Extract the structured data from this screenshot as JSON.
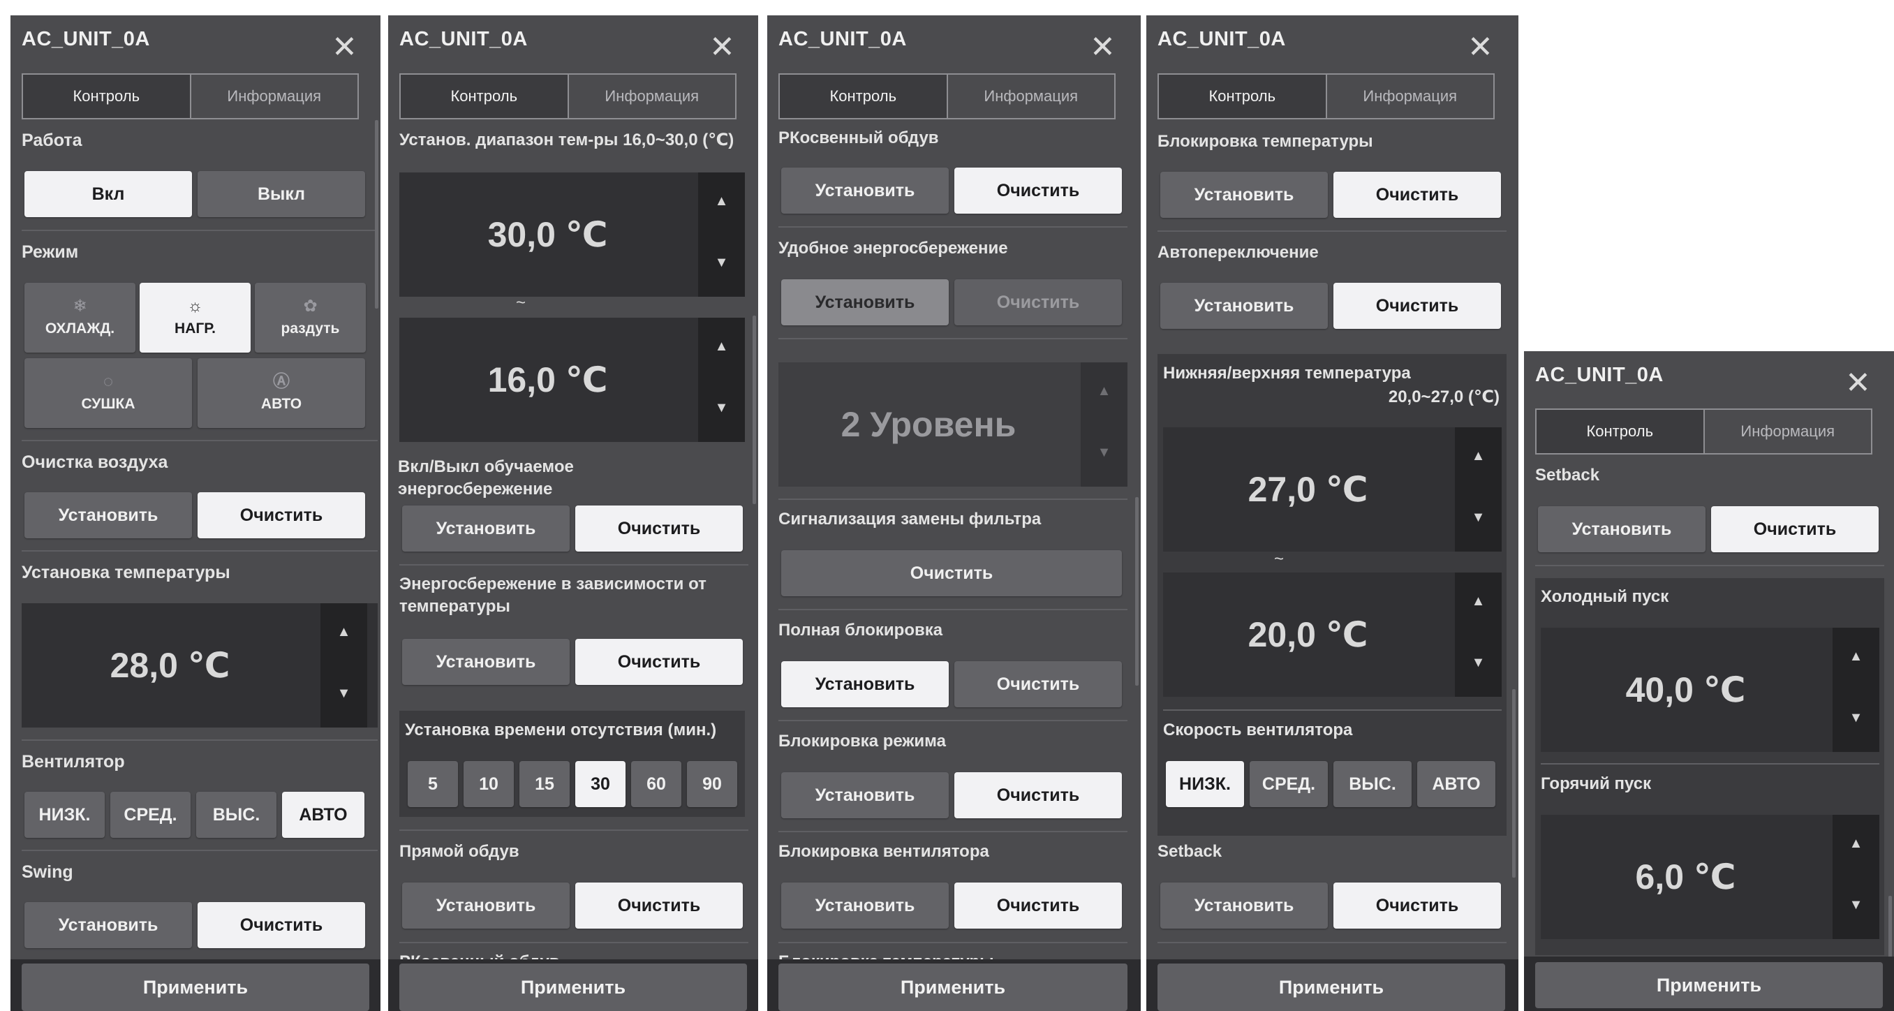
{
  "unit_name": "AC_UNIT_0A",
  "tabs": [
    "Контроль",
    "Информация"
  ],
  "apply_label": "Применить",
  "set_label": "Установить",
  "clear_label": "Очистить",
  "on_label": "Вкл",
  "off_label": "Выкл",
  "tilde": "~",
  "arrow_up": "▲",
  "arrow_down": "▼",
  "panel1": {
    "operation_title": "Работа",
    "mode_title": "Режим",
    "modes": [
      {
        "label": "ОХЛАЖД.",
        "icon": "snowflake-icon",
        "glyph": "❄"
      },
      {
        "label": "НАГР.",
        "icon": "sun-icon",
        "glyph": "☼"
      },
      {
        "label": "раздуть",
        "icon": "fan-icon",
        "glyph": "✿"
      },
      {
        "label": "СУШКА",
        "icon": "droplet-icon",
        "glyph": "💧"
      },
      {
        "label": "АВТО",
        "icon": "auto-icon",
        "glyph": "Ⓐ"
      }
    ],
    "air_clean_title": "Очистка воздуха",
    "temp_title": "Установка температуры",
    "temp_value": "28,0 ℃",
    "fan_title": "Вентилятор",
    "fan_options": [
      "НИЗК.",
      "СРЕД.",
      "ВЫС.",
      "АВТО"
    ],
    "swing_title": "Swing"
  },
  "panel2": {
    "range_title": "Установ. диапазон тем-ры 16,0~30,0 (℃)",
    "upper_value": "30,0 ℃",
    "lower_value": "16,0 ℃",
    "learn_title": "Вкл/Выкл обучаемое энергосбережение",
    "temp_saving_title": "Энергосбережение в зависимости от температуры",
    "absence_title": "Установка времени отсутствия (мин.)",
    "absence_options": [
      "5",
      "10",
      "15",
      "30",
      "60",
      "90"
    ],
    "direct_title": "Прямой обдув",
    "cut_title": "РКосвенный обдув"
  },
  "panel3": {
    "indirect_title": "РКосвенный обдув",
    "comfort_title": "Удобное энергосбережение",
    "level_value": "2 Уровень",
    "filter_title": "Сигнализация замены фильтра",
    "full_lock_title": "Полная блокировка",
    "mode_lock_title": "Блокировка режима",
    "fan_lock_title": "Блокировка вентилятора",
    "cut_title": "Блокировка температуры"
  },
  "panel4": {
    "temp_lock_title": "Блокировка температуры",
    "auto_switch_title": "Автопереключение",
    "lower_upper_title": "Нижняя/верхняя температура",
    "lower_upper_range": "20,0~27,0 (℃)",
    "upper_value": "27,0 ℃",
    "lower_value": "20,0 ℃",
    "fan_speed_title": "Скорость вентилятора",
    "fan_options": [
      "НИЗК.",
      "СРЕД.",
      "ВЫС.",
      "АВТО"
    ],
    "setback_title": "Setback"
  },
  "panel5": {
    "setback_title": "Setback",
    "cold_start_title": "Холодный пуск",
    "cold_value": "40,0 ℃",
    "hot_start_title": "Горячий пуск",
    "hot_value": "6,0 ℃"
  },
  "colors": {
    "panel": "#4b4b4e",
    "selected": "#f2f2f4",
    "button": "#636367",
    "display": "#313134"
  }
}
